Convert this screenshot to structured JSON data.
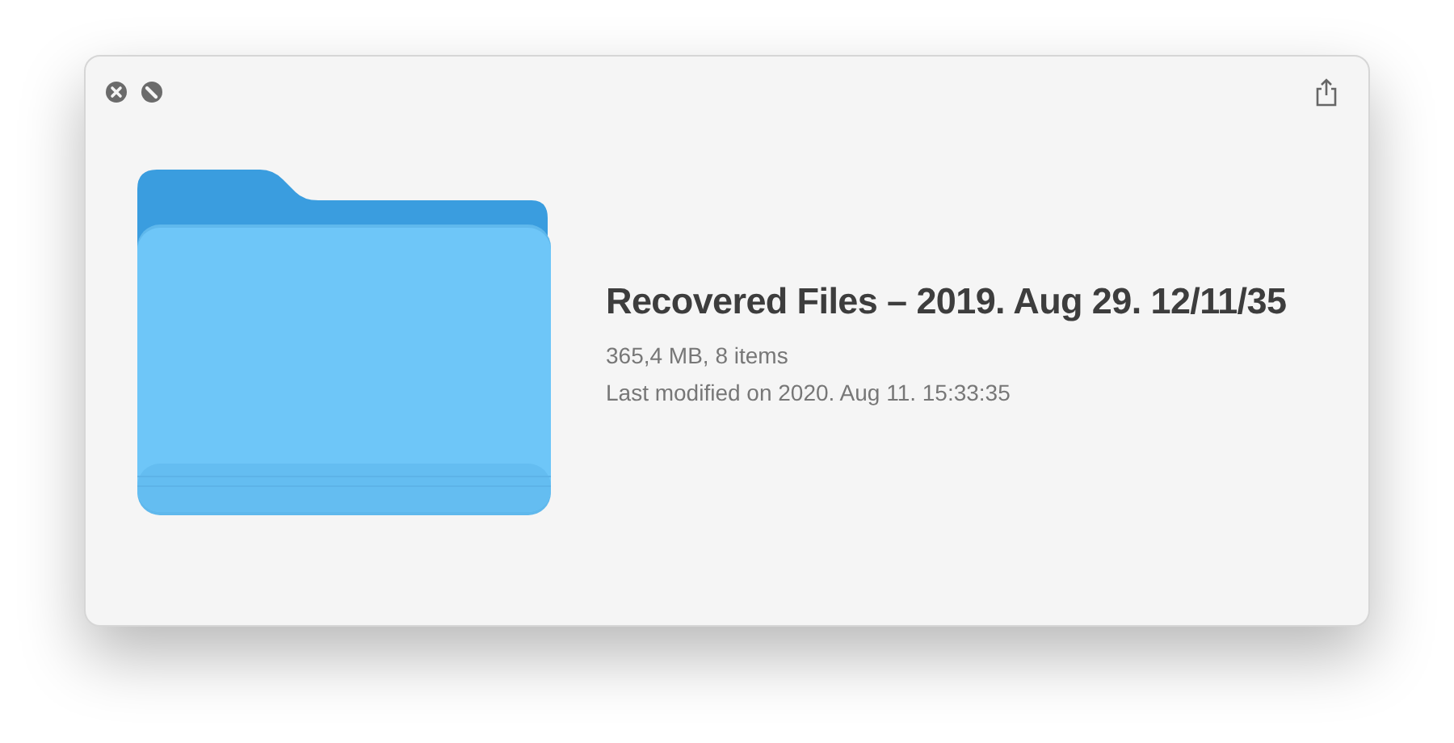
{
  "title": "Recovered Files – 2019. Aug 29. 12/11/35",
  "size_info": "365,4 MB, 8 items",
  "modified": "Last modified on 2020. Aug 11. 15:33:35"
}
